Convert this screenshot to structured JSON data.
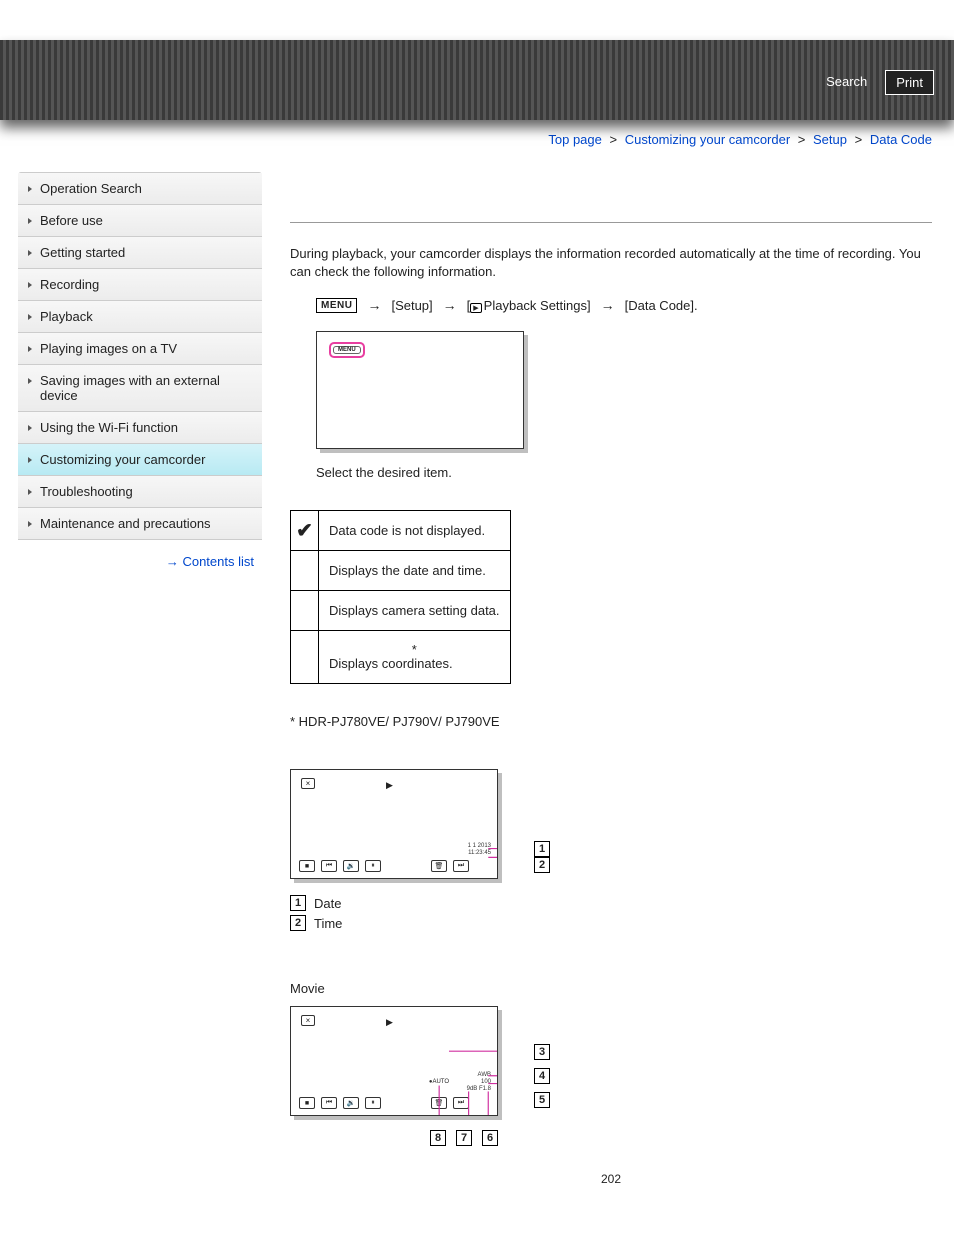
{
  "header": {
    "search": "Search",
    "print": "Print"
  },
  "breadcrumb": {
    "top": "Top page",
    "l1": "Customizing your camcorder",
    "l2": "Setup",
    "l3": "Data Code"
  },
  "sidebar": {
    "items": [
      {
        "label": "Operation Search"
      },
      {
        "label": "Before use"
      },
      {
        "label": "Getting started"
      },
      {
        "label": "Recording"
      },
      {
        "label": "Playback"
      },
      {
        "label": "Playing images on a TV"
      },
      {
        "label": "Saving images with an external device"
      },
      {
        "label": "Using the Wi-Fi function"
      },
      {
        "label": "Customizing your camcorder"
      },
      {
        "label": "Troubleshooting"
      },
      {
        "label": "Maintenance and precautions"
      }
    ],
    "contents_link": "Contents list"
  },
  "main": {
    "intro": "During playback, your camcorder displays the information recorded automatically at the time of recording. You can check the following information.",
    "menu_label": "MENU",
    "path": {
      "setup": "[Setup]",
      "playback_settings": "Playback Settings]",
      "data_code": "[Data Code]."
    },
    "menu_inner": "MENU",
    "select_text": "Select the desired item.",
    "table": {
      "r0": "Data code is not displayed.",
      "r1": "Displays the date and time.",
      "r2": "Displays camera setting data.",
      "r3_star": "*",
      "r3": "Displays coordinates."
    },
    "footnote": "* HDR-PJ780VE/ PJ790V/ PJ790VE",
    "fig1": {
      "date": "1  1 2013",
      "time": "11:23:45",
      "legend1": "Date",
      "legend2": "Time"
    },
    "fig2": {
      "title": "Movie",
      "awb": "AWB",
      "iso": "100",
      "f": "F1.8",
      "db": "9dB",
      "auto": "AUTO"
    },
    "page": "202"
  }
}
